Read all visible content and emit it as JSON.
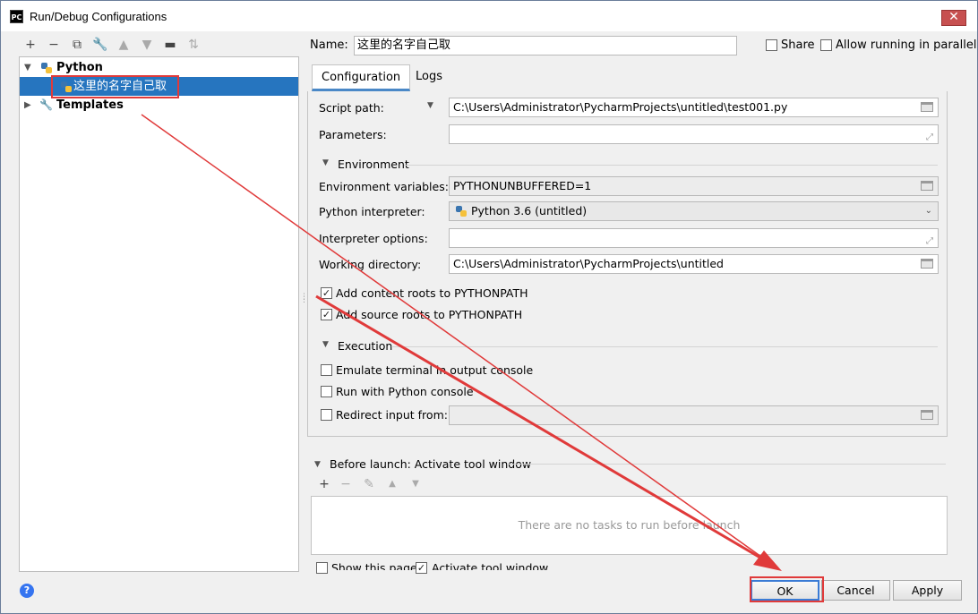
{
  "window": {
    "title": "Run/Debug Configurations",
    "app_icon": "PC"
  },
  "tree": {
    "python_label": "Python",
    "config_label": "这里的名字自己取",
    "templates_label": "Templates"
  },
  "name": {
    "label": "Name:",
    "value": "这里的名字自己取"
  },
  "share": {
    "label": "Share",
    "checked": false
  },
  "parallel": {
    "label": "Allow running in parallel",
    "checked": false
  },
  "tabs": [
    "Configuration",
    "Logs"
  ],
  "config": {
    "script_path_label": "Script path:",
    "script_path_value": "C:\\Users\\Administrator\\PycharmProjects\\untitled\\test001.py",
    "parameters_label": "Parameters:",
    "environment_section": "Environment",
    "env_vars_label": "Environment variables:",
    "env_vars_value": "PYTHONUNBUFFERED=1",
    "interpreter_label": "Python interpreter:",
    "interpreter_value": "Python 3.6 (untitled)",
    "interp_options_label": "Interpreter options:",
    "working_dir_label": "Working directory:",
    "working_dir_value": "C:\\Users\\Administrator\\PycharmProjects\\untitled",
    "add_content_roots": "Add content roots to PYTHONPATH",
    "add_source_roots": "Add source roots to PYTHONPATH",
    "execution_section": "Execution",
    "emulate_terminal": "Emulate terminal in output console",
    "run_with_console": "Run with Python console",
    "redirect_input": "Redirect input from:"
  },
  "before_launch": {
    "label": "Before launch: Activate tool window",
    "empty_text": "There are no tasks to run before launch",
    "show_page_label": "Show this page",
    "activate_label": "Activate tool window"
  },
  "buttons": {
    "ok": "OK",
    "cancel": "Cancel",
    "apply": "Apply",
    "help": "?"
  },
  "colors": {
    "selection": "#2675bf",
    "annotation": "#e03a3a",
    "ok_border": "#3a7bd5"
  }
}
